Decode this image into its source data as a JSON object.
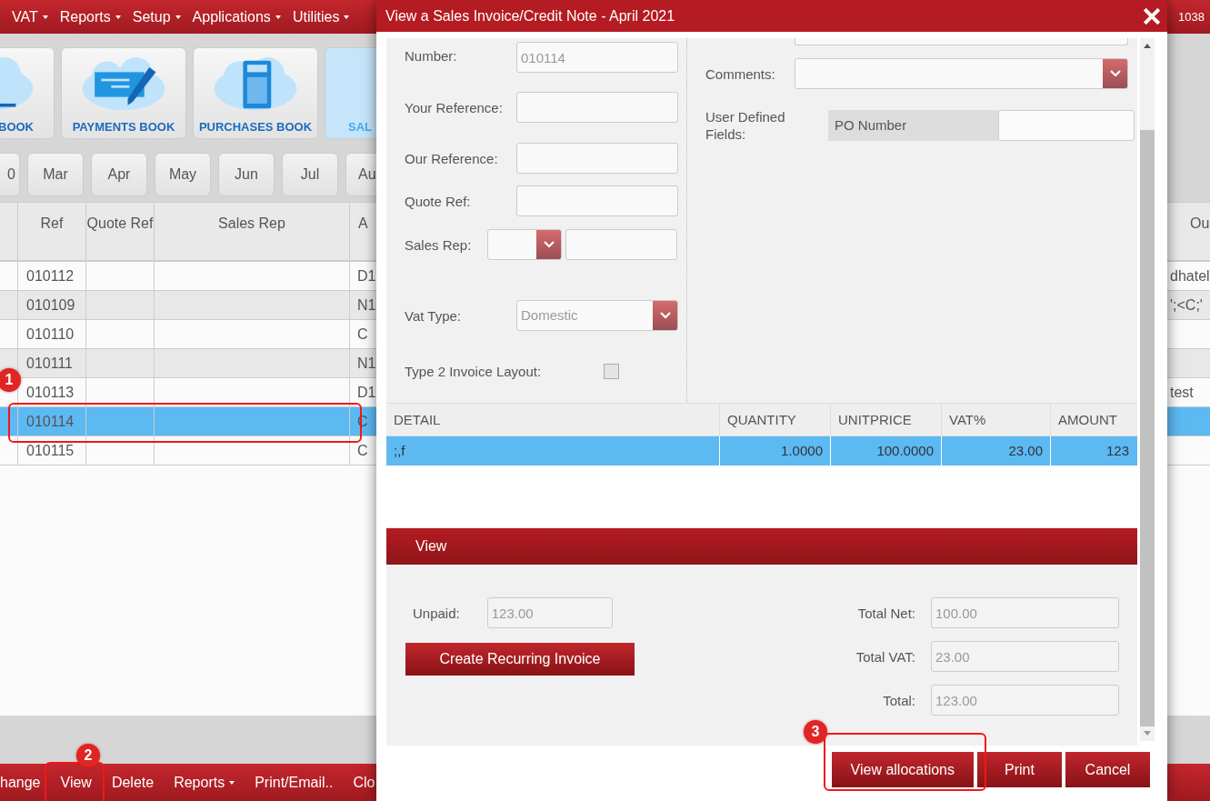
{
  "menu_bar": {
    "items": [
      {
        "label": "VAT",
        "dropdown": true
      },
      {
        "label": "Reports",
        "dropdown": true
      },
      {
        "label": "Setup",
        "dropdown": true
      },
      {
        "label": "Applications",
        "dropdown": true
      },
      {
        "label": "Utilities",
        "dropdown": true
      }
    ],
    "account": "1038"
  },
  "book_tiles": [
    {
      "label": "BOOK",
      "selected": false
    },
    {
      "label": "PAYMENTS BOOK",
      "selected": false
    },
    {
      "label": "PURCHASES BOOK",
      "selected": false
    },
    {
      "label": "SAL",
      "selected": true
    }
  ],
  "months": [
    {
      "label": "0"
    },
    {
      "label": "Mar"
    },
    {
      "label": "Apr"
    },
    {
      "label": "May"
    },
    {
      "label": "Jun"
    },
    {
      "label": "Jul"
    },
    {
      "label": "Au"
    }
  ],
  "table": {
    "columns": [
      {
        "label": "Ref"
      },
      {
        "label": "Quote Ref"
      },
      {
        "label": "Sales Rep"
      },
      {
        "label": "A"
      },
      {
        "label": "Ou"
      }
    ],
    "rows": [
      {
        "ref": "010112",
        "column_4": "D1",
        "column_5": "dhatel",
        "selected": false
      },
      {
        "ref": "010109",
        "column_4": "N1",
        "column_5": "';<C;'",
        "selected": false
      },
      {
        "ref": "010110",
        "column_4": "C",
        "selected": false
      },
      {
        "ref": "010111",
        "column_4": "N1",
        "selected": false
      },
      {
        "ref": "010113",
        "column_4": "D1",
        "column_5": "test",
        "selected": false
      },
      {
        "ref": "010114",
        "column_4": "C",
        "selected": true
      },
      {
        "ref": "010115",
        "column_4": "C",
        "selected": false
      }
    ]
  },
  "bottom_toolbar": [
    {
      "label": "hange",
      "dropdown": false
    },
    {
      "label": "View",
      "dropdown": false
    },
    {
      "label": "Delete",
      "dropdown": false
    },
    {
      "label": "Reports",
      "dropdown": true
    },
    {
      "label": "Print/Email..",
      "dropdown": false
    },
    {
      "label": "Clo",
      "dropdown": false
    }
  ],
  "callouts": [
    {
      "number": "1"
    },
    {
      "number": "2"
    },
    {
      "number": "3"
    }
  ],
  "dialog": {
    "title": "View a Sales Invoice/Credit Note - April 2021",
    "form": [
      {
        "kind": "text",
        "label": "Number:",
        "value": "010114"
      },
      {
        "kind": "text",
        "label": "Your Reference:"
      },
      {
        "kind": "text",
        "label": "Our Reference:"
      },
      {
        "kind": "text",
        "label": "Quote Ref:"
      },
      {
        "kind": "rep",
        "label": "Sales Rep:"
      },
      {
        "kind": "select",
        "label": "Vat Type:",
        "value": "Domestic"
      },
      {
        "kind": "checkbox",
        "label": "Type 2 Invoice Layout:",
        "checked": false
      }
    ],
    "comments": {
      "label": "Comments:"
    },
    "user_defined": {
      "label": "User Defined Fields:",
      "field_name": "PO Number"
    },
    "details": {
      "columns": [
        {
          "label": "DETAIL"
        },
        {
          "label": "QUANTITY"
        },
        {
          "label": "UNITPRICE"
        },
        {
          "label": "VAT%"
        },
        {
          "label": "AMOUNT"
        }
      ],
      "rows": [
        {
          "cells": [
            ";,f",
            "1.0000",
            "100.0000",
            "23.00",
            "123"
          ],
          "selected": true
        }
      ]
    },
    "section_tab": "View",
    "unpaid": {
      "label": "Unpaid:",
      "value": "123.00"
    },
    "recurring_button": "Create Recurring Invoice",
    "totals": [
      {
        "label": "Total Net:",
        "value": "100.00"
      },
      {
        "label": "Total VAT:",
        "value": "23.00"
      },
      {
        "label": "Total:",
        "value": "123.00"
      }
    ],
    "buttons": [
      {
        "label": "View allocations"
      },
      {
        "label": "Print"
      },
      {
        "label": "Cancel"
      }
    ]
  }
}
